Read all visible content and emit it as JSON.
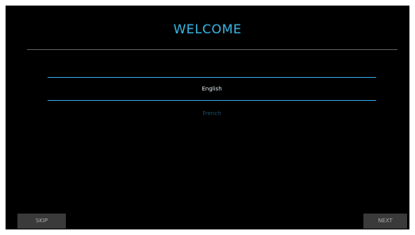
{
  "header": {
    "title": "WELCOME"
  },
  "languages": {
    "items": [
      {
        "label": "English",
        "selected": true
      },
      {
        "label": "French",
        "selected": false
      }
    ]
  },
  "footer": {
    "skip_label": "SKIP",
    "next_label": "NEXT"
  },
  "colors": {
    "accent": "#38b6e4",
    "background": "#000000",
    "button": "#3a3a3a"
  }
}
